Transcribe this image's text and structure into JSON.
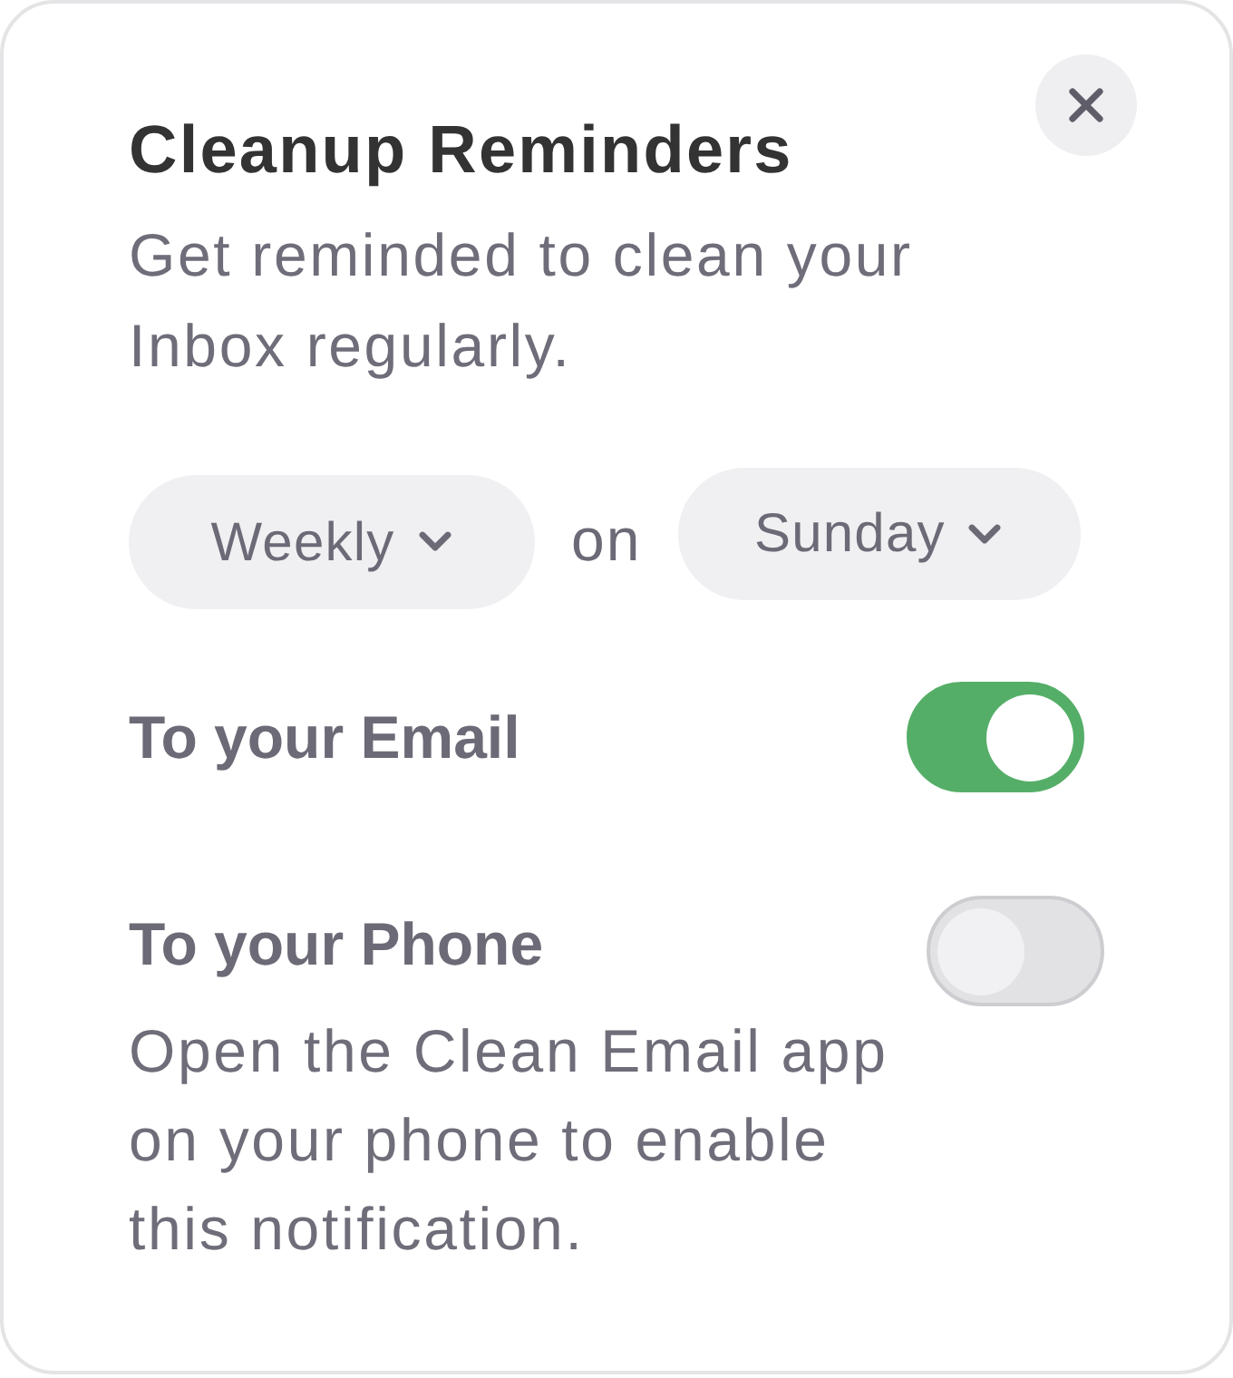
{
  "dialog": {
    "title": "Cleanup Reminders",
    "subtitle": "Get reminded to clean your Inbox regularly."
  },
  "schedule": {
    "frequency": "Weekly",
    "connector": "on",
    "day": "Sunday"
  },
  "channels": [
    {
      "label": "To your Email",
      "on": true
    },
    {
      "label": "To your Phone",
      "on": false,
      "note": "Open the Clean Email app on your phone to enable this notification."
    }
  ]
}
